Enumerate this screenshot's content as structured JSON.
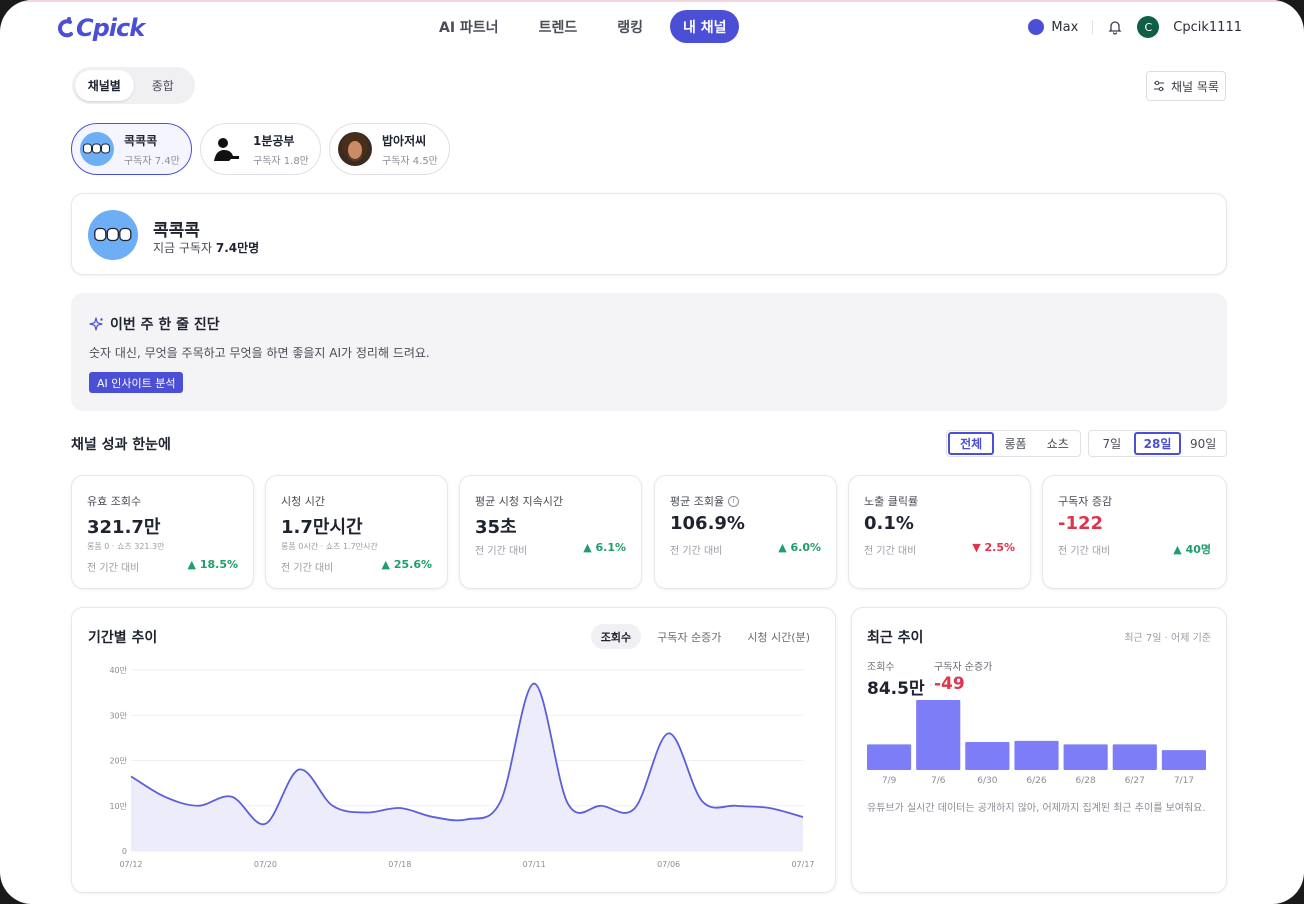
{
  "brand": {
    "logo_text": "Cpick",
    "accent": "#4b4fd6"
  },
  "nav": {
    "items": [
      {
        "label": "AI 파트너",
        "active": false
      },
      {
        "label": "트렌드",
        "active": false
      },
      {
        "label": "랭킹",
        "active": false
      },
      {
        "label": "내 채널",
        "active": true
      }
    ]
  },
  "header": {
    "plan": "Max",
    "avatar_letter": "C",
    "username": "Cpcik1111"
  },
  "view_toggle": {
    "options": [
      "채널별",
      "종합"
    ],
    "selected": "채널별"
  },
  "channel_list_button": "채널 목록",
  "channels": [
    {
      "name": "콕콕콕",
      "subscribers": "구독자 7.4만",
      "active": true
    },
    {
      "name": "1분공부",
      "subscribers": "구독자 1.8만",
      "active": false
    },
    {
      "name": "밥아저씨",
      "subscribers": "구독자 4.5만",
      "active": false
    }
  ],
  "profile": {
    "name": "콕콕콕",
    "subscribers_prefix": "지금 구독자",
    "subscribers_value": "7.4만명"
  },
  "diagnosis": {
    "title": "이번 주 한 줄 진단",
    "description": "숫자 대신, 무엇을 주목하고 무엇을 하면 좋을지 AI가 정리해 드려요.",
    "button": "AI 인사이트 분석"
  },
  "performance": {
    "title": "채널 성과 한눈에",
    "type_filter": {
      "options": [
        "전체",
        "롱폼",
        "쇼츠"
      ],
      "selected": "전체"
    },
    "period_filter": {
      "options": [
        "7일",
        "28일",
        "90일"
      ],
      "selected": "28일"
    }
  },
  "metrics": [
    {
      "label": "유효 조회수",
      "value": "321.7만",
      "sub": "롱폼 0 · 쇼츠 321.3만",
      "compare": "전 기간 대비",
      "change": "18.5%",
      "direction": "up"
    },
    {
      "label": "시청 시간",
      "value": "1.7만시간",
      "sub": "롱폼 0시간 · 쇼츠 1.7만시간",
      "compare": "전 기간 대비",
      "change": "25.6%",
      "direction": "up"
    },
    {
      "label": "평균 시청 지속시간",
      "value": "35초",
      "sub": "",
      "compare": "전 기간 대비",
      "change": "6.1%",
      "direction": "up"
    },
    {
      "label": "평균 조회율",
      "value": "106.9%",
      "sub": "",
      "compare": "전 기간 대비",
      "change": "6.0%",
      "direction": "up",
      "info": true
    },
    {
      "label": "노출 클릭률",
      "value": "0.1%",
      "sub": "",
      "compare": "전 기간 대비",
      "change": "2.5%",
      "direction": "down"
    },
    {
      "label": "구독자 증감",
      "value": "-122",
      "sub": "",
      "compare": "전 기간 대비",
      "change": "40명",
      "direction": "up",
      "negative_value": true
    }
  ],
  "trend": {
    "title": "기간별 추이",
    "tabs": [
      "조회수",
      "구독자 순증가",
      "시청 시간(분)"
    ],
    "selected_tab": "조회수"
  },
  "recent": {
    "title": "최근 추이",
    "note": "최근 7일 · 어제 기준",
    "views_label": "조회수",
    "views_value": "84.5만",
    "subs_label": "구독자 순증가",
    "subs_value": "-49",
    "footnote": "유튜브가 실시간 데이터는 공개하지 않아, 어제까지 집계된 최근 추이를 보여줘요."
  },
  "chart_data": [
    {
      "type": "area",
      "y_tick_labels": [
        "0",
        "10만",
        "20만",
        "30만",
        "40만"
      ],
      "x_tick_labels": [
        "07/12",
        "07/20",
        "07/18",
        "07/11",
        "07/06",
        "07/17"
      ],
      "ylim": [
        0,
        400000
      ],
      "series": [
        {
          "values": [
            165000,
            120000,
            100000,
            120000,
            60000,
            180000,
            100000,
            85000,
            95000,
            75000,
            70000,
            110000,
            370000,
            105000,
            100000,
            95000,
            260000,
            110000,
            100000,
            95000,
            75000
          ]
        }
      ],
      "color": "#5b5fd9"
    },
    {
      "type": "bar",
      "categories": [
        "7/9",
        "7/6",
        "6/30",
        "6/26",
        "6/28",
        "6/27",
        "7/17"
      ],
      "values": [
        44,
        120,
        48,
        50,
        44,
        44,
        34
      ],
      "color": "#7d7ef7"
    }
  ]
}
